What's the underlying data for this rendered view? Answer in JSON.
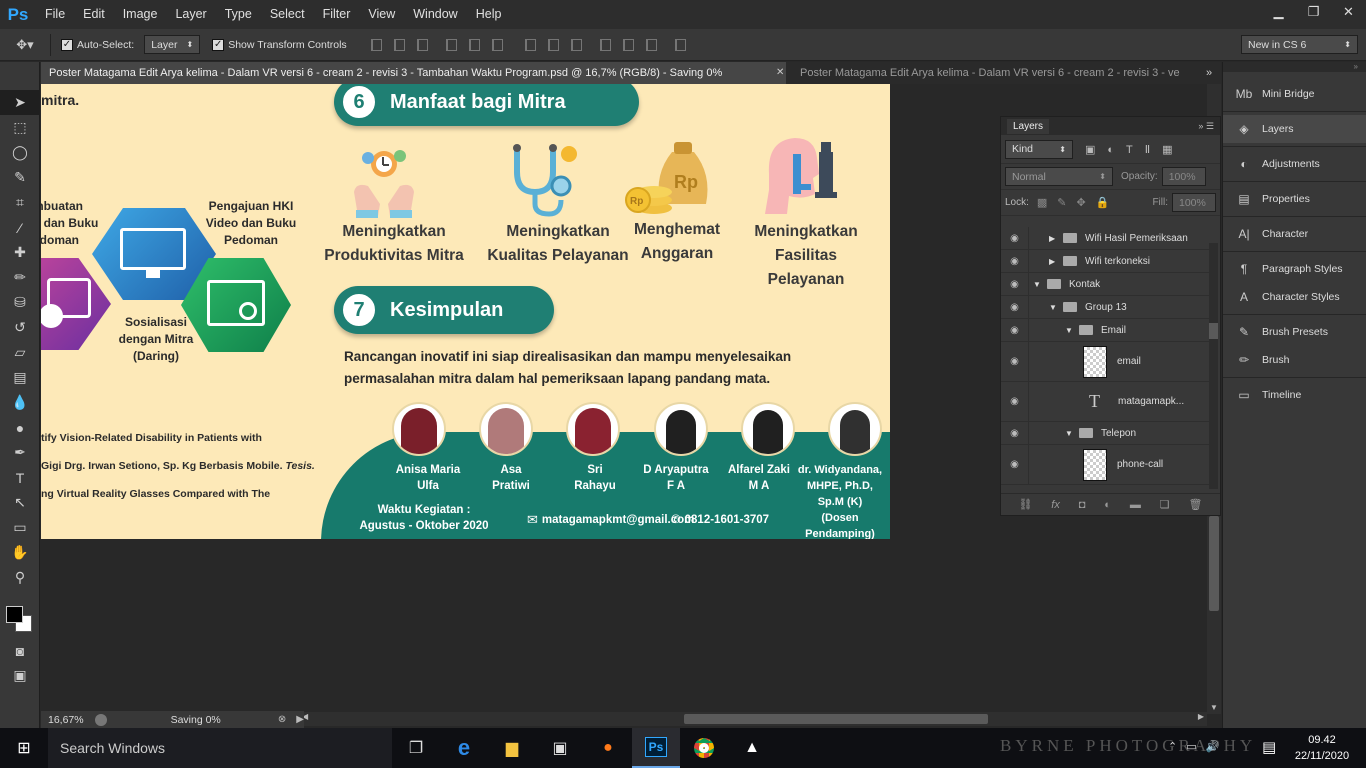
{
  "menubar": {
    "logo": "Ps",
    "items": [
      "File",
      "Edit",
      "Image",
      "Layer",
      "Type",
      "Select",
      "Filter",
      "View",
      "Window",
      "Help"
    ]
  },
  "options": {
    "auto_select_label": "Auto-Select:",
    "auto_select_value": "Layer",
    "show_transform_label": "Show Transform Controls",
    "workspace": "New in CS 6"
  },
  "tabs": [
    {
      "label": "Poster Matagama Edit Arya kelima - Dalam VR versi 6 - cream 2 - revisi 3 - Tambahan Waktu Program.psd @ 16,7% (RGB/8) - Saving 0%",
      "active": true
    },
    {
      "label": "Poster Matagama Edit Arya kelima - Dalam VR versi 6 - cream 2 - revisi 3 - ve",
      "active": false
    }
  ],
  "poster": {
    "top_text": "mitra.",
    "section6": {
      "num": "6",
      "title": "Manfaat bagi Mitra"
    },
    "benefits": [
      "Meningkatkan\nProduktivitas Mitra",
      "Meningkatkan\nKualitas Pelayanan",
      "Menghemat\nAnggaran",
      "Meningkatkan\nFasilitas Pelayanan"
    ],
    "money_label": "Rp",
    "hex_labels": {
      "left": "mbuatan\no dan Buku\nedoman",
      "right": "Pengajuan HKI\nVideo dan Buku\nPedoman",
      "bottom": "Sosialisasi\ndengan Mitra\n(Daring)"
    },
    "section7": {
      "num": "7",
      "title": "Kesimpulan"
    },
    "conclusion": "Rancangan inovatif ini siap direalisasikan dan mampu menyelesaikan\npermasalahan mitra dalam hal pemeriksaan lapang pandang mata.",
    "refs": [
      "tify Vision-Related Disability in Patients with",
      "Gigi Drg. Irwan Setiono, Sp. Kg Berbasis Mobile.",
      "Tesis.",
      "ng Virtual Reality Glasses Compared with The"
    ],
    "members": [
      {
        "name": "Anisa Maria\nUlfa",
        "hijab": "#7a1f2a"
      },
      {
        "name": "Asa\nPratiwi",
        "hijab": "#b07a7a"
      },
      {
        "name": "Sri\nRahayu",
        "hijab": "#8a2230"
      },
      {
        "name": "D Aryaputra\nF A",
        "hijab": "#202020"
      },
      {
        "name": "Alfarel Zaki\nM A",
        "hijab": "#202020"
      },
      {
        "name": "dr. Widyandana,\nMHPE, Ph.D,\nSp.M (K)\n(Dosen Pendamping)",
        "hijab": "#303030"
      }
    ],
    "waktu": "Waktu Kegiatan :\nAgustus - Oktober 2020",
    "email": "matagamapkmt@gmail.com",
    "phone": "0812-1601-3707"
  },
  "status": {
    "zoom": "16,67%",
    "saving": "Saving 0%"
  },
  "layers_panel": {
    "tab": "Layers",
    "kind": "Kind",
    "blend": "Normal",
    "opacity_label": "Opacity:",
    "opacity": "100%",
    "lock_label": "Lock:",
    "fill_label": "Fill:",
    "fill": "100%",
    "rows": [
      {
        "name": "Wifi Hasil Pemeriksaan",
        "type": "group",
        "indent": 1,
        "open": false
      },
      {
        "name": "Wifi terkoneksi",
        "type": "group",
        "indent": 1,
        "open": false
      },
      {
        "name": "Kontak",
        "type": "group",
        "indent": 0,
        "open": true
      },
      {
        "name": "Group 13",
        "type": "group",
        "indent": 1,
        "open": true
      },
      {
        "name": "Email",
        "type": "group",
        "indent": 2,
        "open": true
      },
      {
        "name": "email",
        "type": "smart",
        "indent": 3
      },
      {
        "name": "matagamapk...",
        "type": "text",
        "indent": 3
      },
      {
        "name": "Telepon",
        "type": "group",
        "indent": 2,
        "open": true
      },
      {
        "name": "phone-call",
        "type": "smart",
        "indent": 3
      }
    ]
  },
  "dock": [
    "Mini Bridge",
    "Layers",
    "Adjustments",
    "Properties",
    "Character",
    "Paragraph Styles",
    "Character Styles",
    "Brush Presets",
    "Brush",
    "Timeline"
  ],
  "taskbar": {
    "search": "Search Windows",
    "time": "09.42",
    "date": "22/11/2020",
    "wallpaper_text": "BYRNE PHOTOGRAPHY"
  }
}
